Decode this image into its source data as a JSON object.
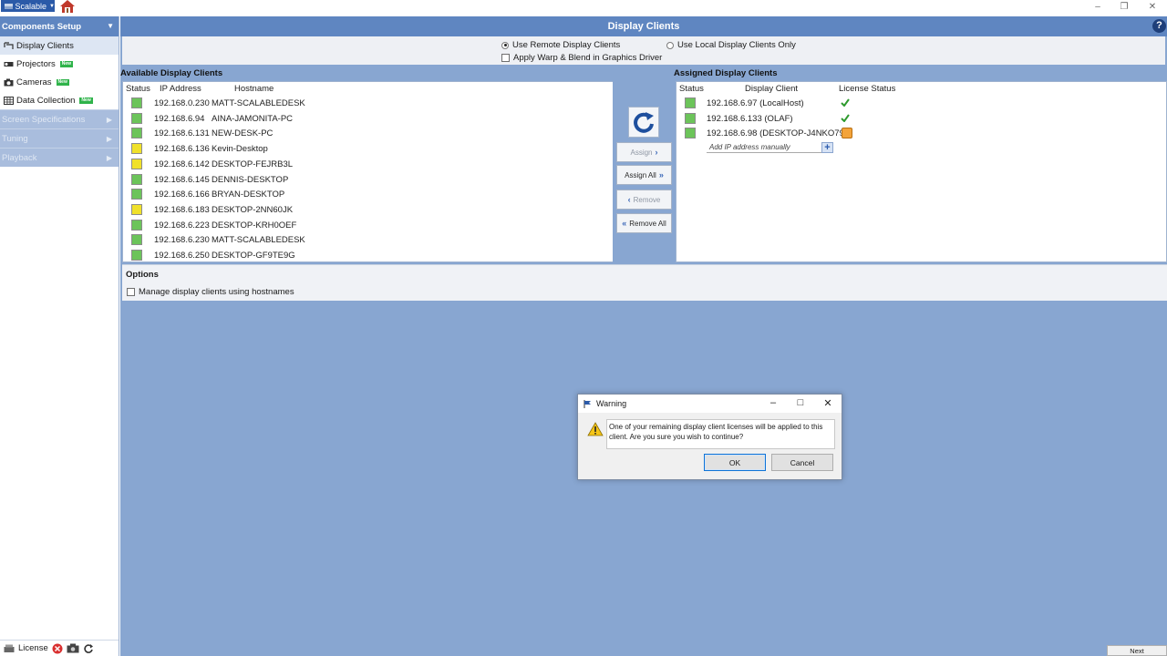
{
  "titlebar": {
    "app_button": "Scalable",
    "controls": [
      "–",
      "❐",
      "✕"
    ]
  },
  "sidebar": {
    "header": "Components Setup",
    "items": [
      {
        "label": "Display Clients",
        "icon": "display-clients-icon",
        "active": true
      },
      {
        "label": "Projectors",
        "icon": "projector-icon",
        "badge": "New"
      },
      {
        "label": "Cameras",
        "icon": "camera-icon",
        "badge": "New"
      },
      {
        "label": "Data Collection",
        "icon": "data-collection-icon",
        "badge": "New"
      }
    ],
    "sections": [
      "Screen Specifications",
      "Tuning",
      "Playback"
    ],
    "bottom": {
      "license_label": "License"
    }
  },
  "main": {
    "title": "Display Clients",
    "help": "?",
    "mode": {
      "remote_label": "Use Remote Display Clients",
      "local_label": "Use Local Display Clients Only",
      "selected": "remote",
      "warp_label": "Apply Warp & Blend in Graphics Driver"
    },
    "available": {
      "title": "Available Display Clients",
      "columns": [
        "Status",
        "IP Address",
        "Hostname"
      ],
      "rows": [
        {
          "status": "green",
          "ip": "192.168.0.230",
          "hostname": "MATT-SCALABLEDESK"
        },
        {
          "status": "green",
          "ip": "192.168.6.94",
          "hostname": "AINA-JAMONITA-PC"
        },
        {
          "status": "green",
          "ip": "192.168.6.131",
          "hostname": "NEW-DESK-PC"
        },
        {
          "status": "yellow",
          "ip": "192.168.6.136",
          "hostname": "Kevin-Desktop"
        },
        {
          "status": "yellow",
          "ip": "192.168.6.142",
          "hostname": "DESKTOP-FEJRB3L"
        },
        {
          "status": "green",
          "ip": "192.168.6.145",
          "hostname": "DENNIS-DESKTOP"
        },
        {
          "status": "green",
          "ip": "192.168.6.166",
          "hostname": "BRYAN-DESKTOP"
        },
        {
          "status": "yellow",
          "ip": "192.168.6.183",
          "hostname": "DESKTOP-2NN60JK"
        },
        {
          "status": "green",
          "ip": "192.168.6.223",
          "hostname": "DESKTOP-KRH0OEF"
        },
        {
          "status": "green",
          "ip": "192.168.6.230",
          "hostname": "MATT-SCALABLEDESK"
        },
        {
          "status": "green",
          "ip": "192.168.6.250",
          "hostname": "DESKTOP-GF9TE9G"
        }
      ]
    },
    "buttons": {
      "assign": "Assign",
      "assign_all": "Assign All",
      "remove": "Remove",
      "remove_all": "Remove All"
    },
    "assigned": {
      "title": "Assigned Display Clients",
      "columns": [
        "Status",
        "Display Client",
        "License Status"
      ],
      "rows": [
        {
          "status": "green",
          "client": "192.168.6.97 (LocalHost)",
          "license": "check"
        },
        {
          "status": "green",
          "client": "192.168.6.133 (OLAF)",
          "license": "check"
        },
        {
          "status": "green",
          "client": "192.168.6.98 (DESKTOP-J4NKO79)",
          "license": "pending"
        }
      ],
      "add_placeholder": "Add IP address manually"
    },
    "options": {
      "title": "Options",
      "hostnames_label": "Manage display clients using hostnames"
    },
    "next_label": "Next"
  },
  "dialog": {
    "title": "Warning",
    "message": "One of your remaining display client licenses will be applied to this client.  Are you sure you wish to continue?",
    "ok_label": "OK",
    "cancel_label": "Cancel"
  },
  "colors": {
    "accent": "#5f86c1",
    "workspace": "#88a6d1",
    "status_green": "#6cc45a",
    "status_yellow": "#f0e12a"
  }
}
